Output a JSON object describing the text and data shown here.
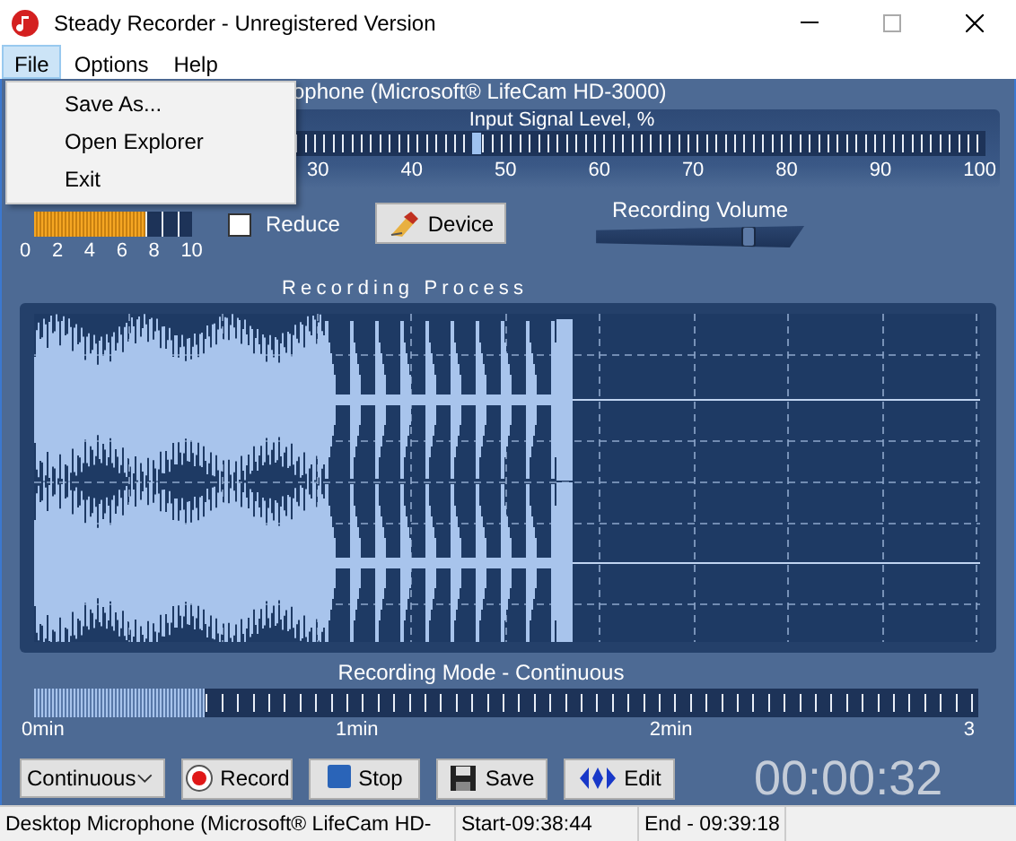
{
  "window": {
    "title": "Steady Recorder - Unregistered Version"
  },
  "menu": [
    {
      "label": "File",
      "selected": true
    },
    {
      "label": "Options",
      "selected": false
    },
    {
      "label": "Help",
      "selected": false
    }
  ],
  "file_menu": {
    "items": [
      "Save As...",
      "Open Explorer",
      "Exit"
    ]
  },
  "device_title": "ophone (Microsoft® LifeCam HD-3000)",
  "input_signal": {
    "title": "Input Signal Level, %",
    "level": 0.46,
    "scale": [
      "30",
      "40",
      "50",
      "60",
      "70",
      "80",
      "90",
      "100"
    ]
  },
  "dc_offset": {
    "level": 0.7,
    "scale": [
      "0",
      "2",
      "4",
      "6",
      "8",
      "10"
    ]
  },
  "reduce": {
    "label": "Reduce",
    "checked": false
  },
  "device_button": {
    "label": "Device"
  },
  "recording_volume": {
    "label": "Recording Volume",
    "level": 0.75
  },
  "recording_process": {
    "title": "Recording Process"
  },
  "recording_mode": {
    "title": "Recording Mode - Continuous",
    "level": 0.18,
    "scale": [
      "0min",
      "1min",
      "2min",
      "3"
    ]
  },
  "mode_select": {
    "value": "Continuous"
  },
  "buttons": [
    {
      "kind": "record",
      "label": "Record"
    },
    {
      "kind": "stop",
      "label": "Stop"
    },
    {
      "kind": "save",
      "label": "Save"
    },
    {
      "kind": "edit",
      "label": "Edit"
    }
  ],
  "timer": "00:00:32",
  "status_bar": [
    "Desktop Microphone (Microsoft® LifeCam HD-",
    "Start-09:38:44",
    "End - 09:39:18"
  ]
}
